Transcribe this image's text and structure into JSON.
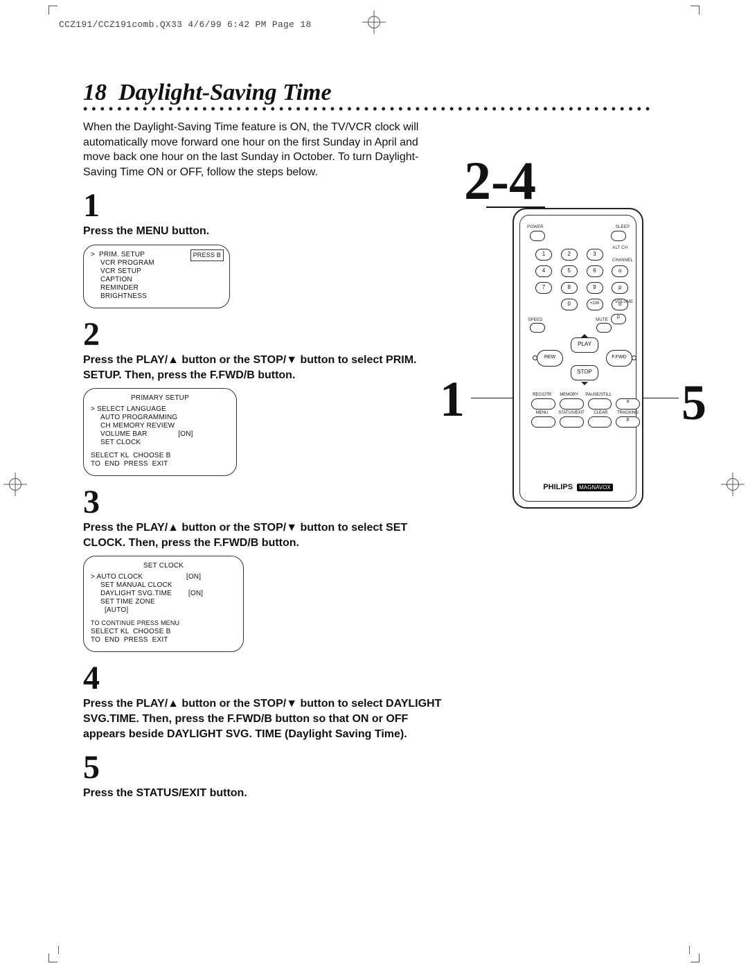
{
  "imprint": "CCZ191/CCZ191comb.QX33  4/6/99 6:42 PM  Page 18",
  "pagenum": "18",
  "title": "Daylight-Saving Time",
  "intro": "When the Daylight-Saving Time feature is ON, the TV/VCR clock will automatically move forward one hour on the first Sunday in April and move back one hour on the last Sunday in October. To turn Daylight-Saving Time ON or OFF, follow the steps below.",
  "steps": {
    "s1": {
      "num": "1",
      "text": "Press the MENU button."
    },
    "s2": {
      "num": "2",
      "text": "Press the PLAY/▲ button or the STOP/▼ button to select PRIM. SETUP. Then, press the F.FWD/B  button."
    },
    "s3": {
      "num": "3",
      "text": "Press the PLAY/▲ button or the STOP/▼ button to select SET CLOCK. Then, press the F.FWD/B  button."
    },
    "s4": {
      "num": "4",
      "text": "Press the PLAY/▲ button or the STOP/▼ button to select DAYLIGHT SVG.TIME. Then, press the F.FWD/B  button so that ON or OFF appears beside DAYLIGHT SVG. TIME (Daylight Saving Time)."
    },
    "s5": {
      "num": "5",
      "text": "Press the STATUS/EXIT button."
    }
  },
  "osd1": {
    "items": [
      "PRIM. SETUP",
      "VCR PROGRAM",
      "VCR SETUP",
      "CAPTION",
      "REMINDER",
      "BRIGHTNESS"
    ],
    "box": "PRESS B"
  },
  "osd2": {
    "title": "PRIMARY SETUP",
    "items": [
      "SELECT LANGUAGE",
      "AUTO PROGRAMMING",
      "CH MEMORY REVIEW",
      "VOLUME BAR               [ON]",
      "SET CLOCK"
    ],
    "footer": [
      "SELECT KL  CHOOSE B",
      "TO  END  PRESS  EXIT"
    ]
  },
  "osd3": {
    "title": "SET CLOCK",
    "items": [
      "AUTO CLOCK                     [ON]",
      "SET MANUAL CLOCK",
      "DAYLIGHT SVG.TIME        [ON]",
      "SET TIME ZONE",
      "  [AUTO]"
    ],
    "footer": [
      "TO CONTINUE PRESS MENU",
      "SELECT KL  CHOOSE B",
      "TO  END  PRESS  EXIT"
    ]
  },
  "figure": {
    "n1": "1",
    "n24": "2-4",
    "n5": "5"
  },
  "remote": {
    "top_left_label": "POWER",
    "top_right_label": "SLEEP",
    "keypad": [
      "1",
      "2",
      "3",
      "",
      "4",
      "5",
      "6",
      "o",
      "7",
      "8",
      "9",
      "p",
      "",
      "0",
      "+100",
      "o"
    ],
    "keypad_side_labels": [
      "ALT CH",
      "CHANNEL",
      "",
      "VOLUME"
    ],
    "below_keypad_left": "SPEED",
    "below_keypad_mid": "MUTE",
    "below_keypad_right": "p",
    "play": "PLAY",
    "stop": "STOP",
    "rew": "REW",
    "ffwd": "F.FWD",
    "row1_labels": [
      "REC/OTR",
      "MEMORY",
      "PAUSE/STILL",
      ""
    ],
    "row2_labels": [
      "MENU",
      "STATUS/EXIT",
      "CLEAR",
      "TRACKING"
    ],
    "row2_btns": [
      "",
      "",
      "",
      "o"
    ],
    "row3_btns": [
      "",
      "",
      "",
      "p"
    ],
    "brand": "PHILIPS",
    "brand_tag": "MAGNAVOX"
  }
}
